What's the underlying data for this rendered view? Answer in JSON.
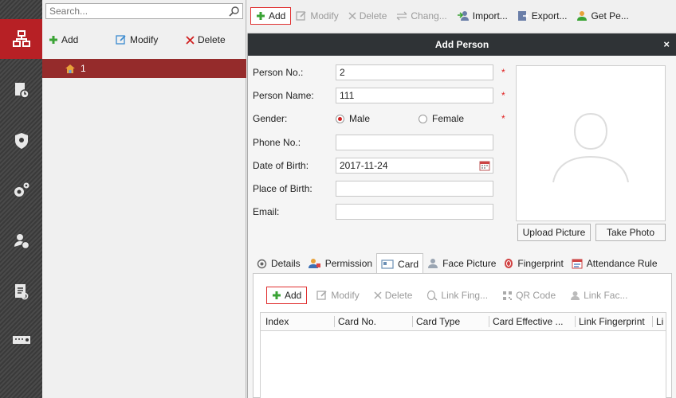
{
  "org": {
    "search_placeholder": "Search...",
    "toolbar": {
      "add": "Add",
      "modify": "Modify",
      "delete": "Delete"
    },
    "tree_root": "1"
  },
  "toolbar": {
    "add": "Add",
    "modify": "Modify",
    "delete": "Delete",
    "change": "Chang...",
    "import": "Import...",
    "export": "Export...",
    "get": "Get Pe..."
  },
  "dialog": {
    "title": "Add Person",
    "close": "×",
    "fields": {
      "person_no": {
        "label": "Person No.:",
        "value": "2"
      },
      "person_name": {
        "label": "Person Name:",
        "value": "111"
      },
      "gender": {
        "label": "Gender:",
        "male": "Male",
        "female": "Female",
        "selected": "Male"
      },
      "phone": {
        "label": "Phone No.:",
        "value": ""
      },
      "dob": {
        "label": "Date of Birth:",
        "value": "2017-11-24"
      },
      "pob": {
        "label": "Place of Birth:",
        "value": ""
      },
      "email": {
        "label": "Email:",
        "value": ""
      }
    },
    "required_mark": "*",
    "upload_picture": "Upload Picture",
    "take_photo": "Take Photo",
    "tabs": [
      "Details",
      "Permission",
      "Card",
      "Face Picture",
      "Fingerprint",
      "Attendance Rule"
    ],
    "active_tab": "Card",
    "card_toolbar": {
      "add": "Add",
      "modify": "Modify",
      "delete": "Delete",
      "link_fing": "Link Fing...",
      "qr_code": "QR Code",
      "link_fac": "Link Fac..."
    },
    "columns": [
      "Index",
      "Card No.",
      "Card Type",
      "Card Effective ...",
      "Link Fingerprint",
      "Li"
    ]
  },
  "colors": {
    "accent_red": "#b72025",
    "tree_selected": "#952b2b",
    "add_green": "#3aa335"
  }
}
